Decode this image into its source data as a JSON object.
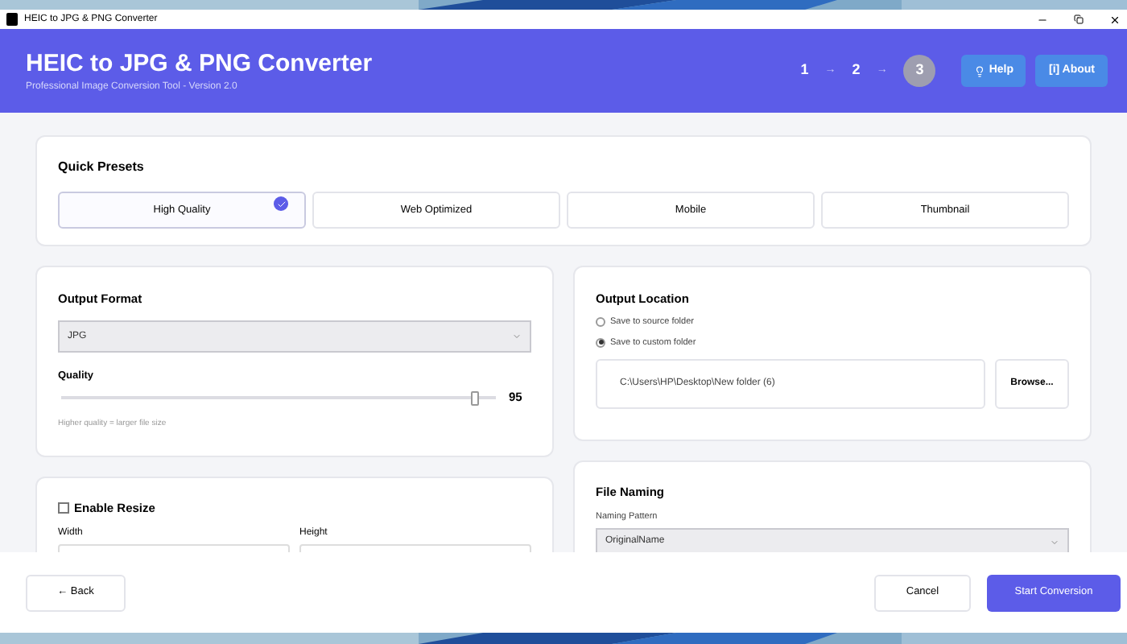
{
  "window": {
    "title": "HEIC to JPG & PNG Converter"
  },
  "header": {
    "title": "HEIC to JPG & PNG Converter",
    "subtitle": "Professional Image Conversion Tool - Version 2.0",
    "steps": [
      {
        "label": "1",
        "selected": false
      },
      {
        "label": "2",
        "selected": false
      },
      {
        "label": "3",
        "selected": true
      }
    ],
    "arrows": [
      "→",
      "→"
    ],
    "buttons": [
      {
        "label": "Help",
        "kind": "help"
      },
      {
        "label": "[i] About",
        "kind": "about"
      }
    ]
  },
  "presets": {
    "title": "Quick Presets",
    "items": [
      {
        "label": "High Quality",
        "selected": true
      },
      {
        "label": "Web Optimized",
        "selected": false
      },
      {
        "label": "Mobile",
        "selected": false
      },
      {
        "label": "Thumbnail",
        "selected": false
      }
    ]
  },
  "output_format": {
    "title": "Output Format",
    "value": "JPG",
    "quality_label": "Quality",
    "level": 0.95,
    "reading": "95",
    "hint": "Higher quality = larger file size"
  },
  "resize": {
    "label": "Enable Resize",
    "checked": false,
    "width_label": "Width",
    "height_label": "Height"
  },
  "output_location": {
    "title": "Output Location",
    "options": [
      {
        "label": "Save to source folder",
        "selected": false
      },
      {
        "label": "Save to custom folder",
        "selected": true
      }
    ],
    "path": "C:\\Users\\HP\\Desktop\\New folder (6)",
    "browse": "Browse..."
  },
  "file_naming": {
    "title": "File Naming",
    "pattern_label": "Naming Pattern",
    "pattern": "OriginalName"
  },
  "footer": {
    "back": "← Back",
    "cancel": "Cancel",
    "start": "Start Conversion"
  }
}
